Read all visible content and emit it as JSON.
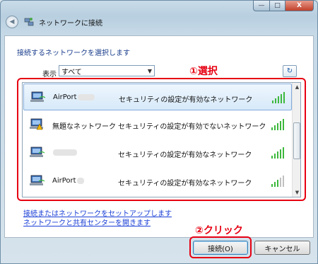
{
  "window": {
    "title": "ネットワークに接続",
    "controls": {
      "minimize": "—",
      "maximize": "□",
      "close": "X"
    }
  },
  "instruction": "接続するネットワークを選択します",
  "filter": {
    "label": "表示",
    "selected": "すべて"
  },
  "annotations": {
    "step1": "①選択",
    "step2": "②クリック"
  },
  "networks": [
    {
      "name": "AirPort",
      "status": "セキュリティの設定が有効なネットワーク",
      "signal_bars": 5,
      "selected": true
    },
    {
      "name": "無題なネットワーク",
      "status": "セキュリティの設定が有効でないネットワーク",
      "signal_bars": 5,
      "selected": false
    },
    {
      "name": "",
      "status": "セキュリティの設定が有効なネットワーク",
      "signal_bars": 5,
      "selected": false
    },
    {
      "name": "AirPort",
      "status": "セキュリティの設定が有効なネットワーク",
      "signal_bars": 3,
      "selected": false
    }
  ],
  "links": {
    "setup": "接続またはネットワークをセットアップします",
    "sharing_center": "ネットワークと共有センターを開きます"
  },
  "buttons": {
    "connect": "接続(O)",
    "cancel": "キャンセル"
  },
  "colors": {
    "annotation": "#e60012",
    "link": "#1a3fd6",
    "signal": "#3cb83c"
  }
}
